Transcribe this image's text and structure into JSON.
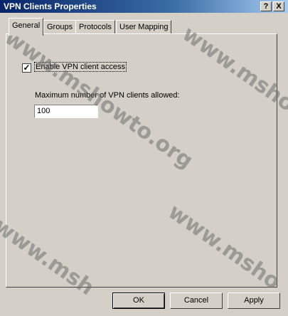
{
  "window": {
    "title": "VPN Clients Properties",
    "help_button": "?",
    "close_button": "X"
  },
  "tabs": [
    {
      "label": "General",
      "active": true
    },
    {
      "label": "Groups",
      "active": false
    },
    {
      "label": "Protocols",
      "active": false
    },
    {
      "label": "User Mapping",
      "active": false
    }
  ],
  "general": {
    "enable_checkbox": {
      "label": "Enable VPN client access",
      "checked": true,
      "mark": "✓"
    },
    "max_clients_label": "Maximum number of VPN clients allowed:",
    "max_clients_value": "100"
  },
  "buttons": {
    "ok": "OK",
    "cancel": "Cancel",
    "apply": "Apply"
  },
  "watermark": {
    "text": "www.mshowto.org",
    "text_partial_top_right": "www.mshowto",
    "text_partial_bottom_right": "www.msho",
    "text_partial_bottom_left": "www.msh"
  }
}
